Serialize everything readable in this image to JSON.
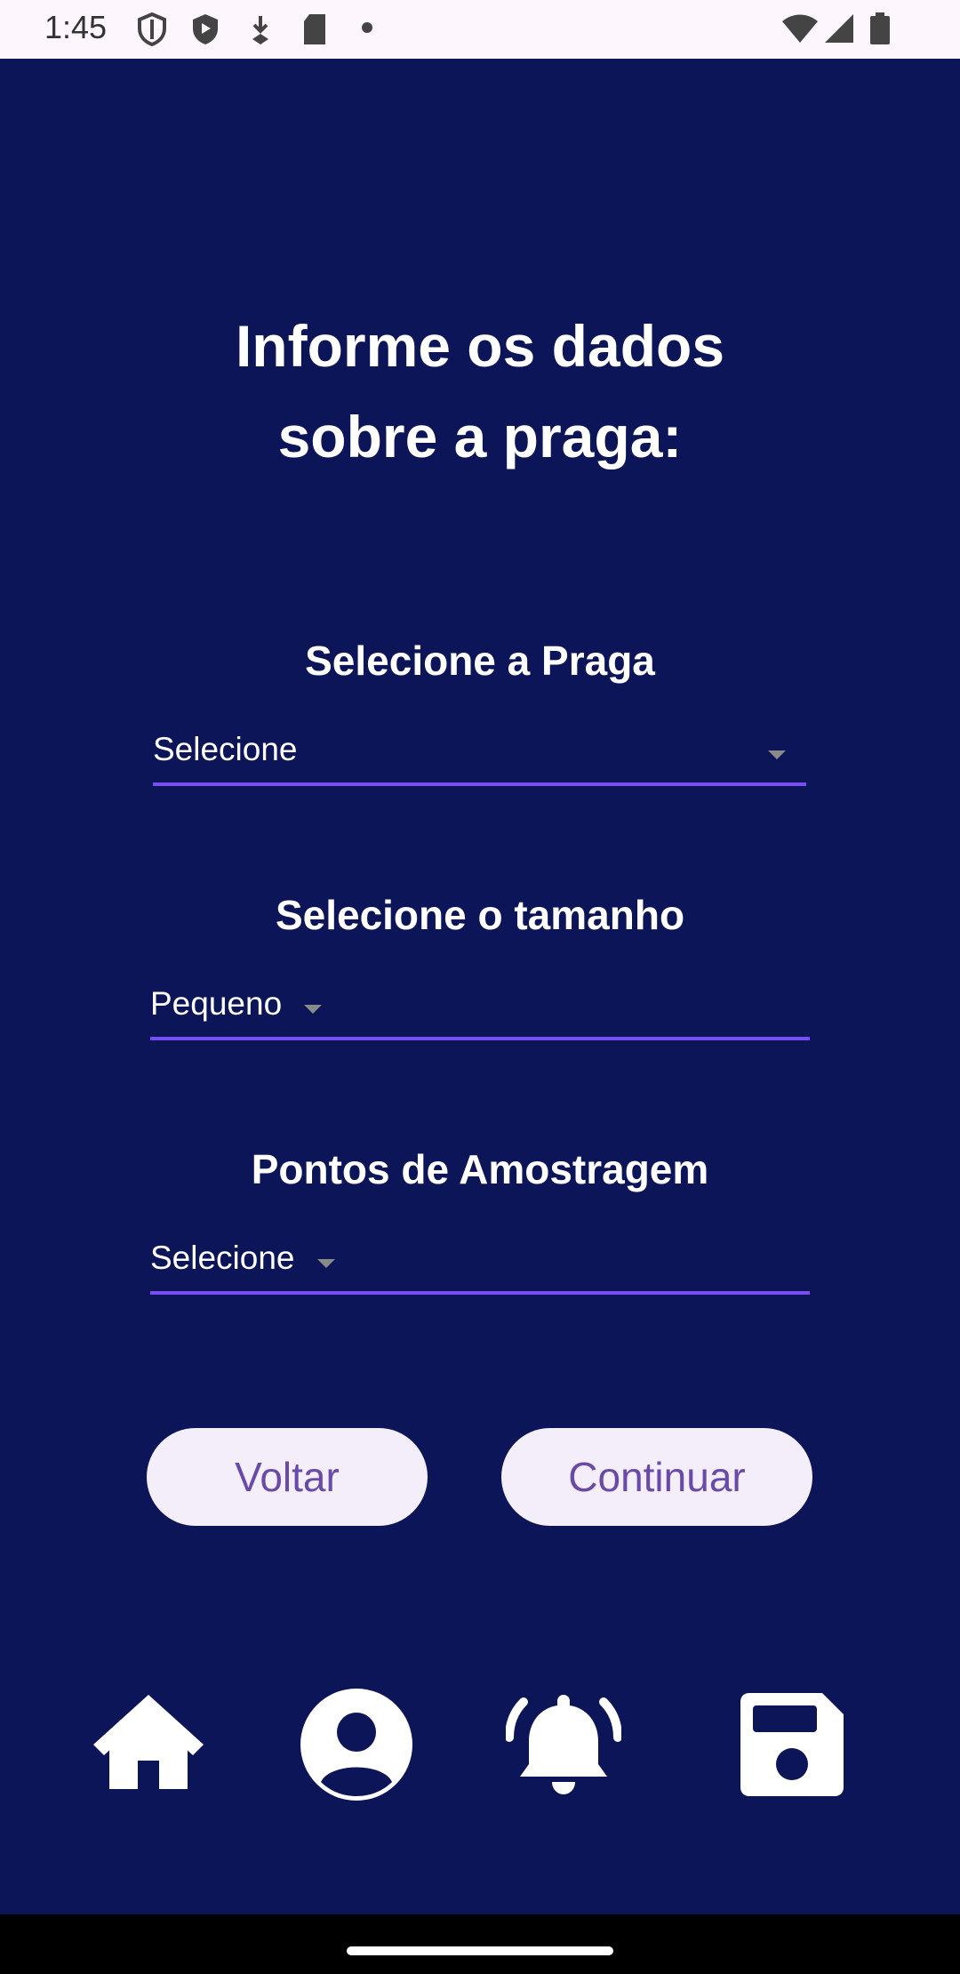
{
  "status_bar": {
    "time": "1:45"
  },
  "screen": {
    "title_line1": "Informe os dados",
    "title_line2": "sobre a praga:"
  },
  "fields": {
    "pest": {
      "label": "Selecione a Praga",
      "value": "Selecione"
    },
    "size": {
      "label": "Selecione o tamanho",
      "value": "Pequeno"
    },
    "points": {
      "label": "Pontos de Amostragem",
      "value": "Selecione"
    }
  },
  "buttons": {
    "back": "Voltar",
    "continue": "Continuar"
  },
  "bottom_nav": {
    "icons": [
      "home-icon",
      "account-icon",
      "notification-bell-icon",
      "save-icon"
    ]
  },
  "colors": {
    "background": "#0d1559",
    "underline": "#7b4ef3",
    "button_bg": "#f3eefa",
    "button_text": "#6a4aa8"
  }
}
